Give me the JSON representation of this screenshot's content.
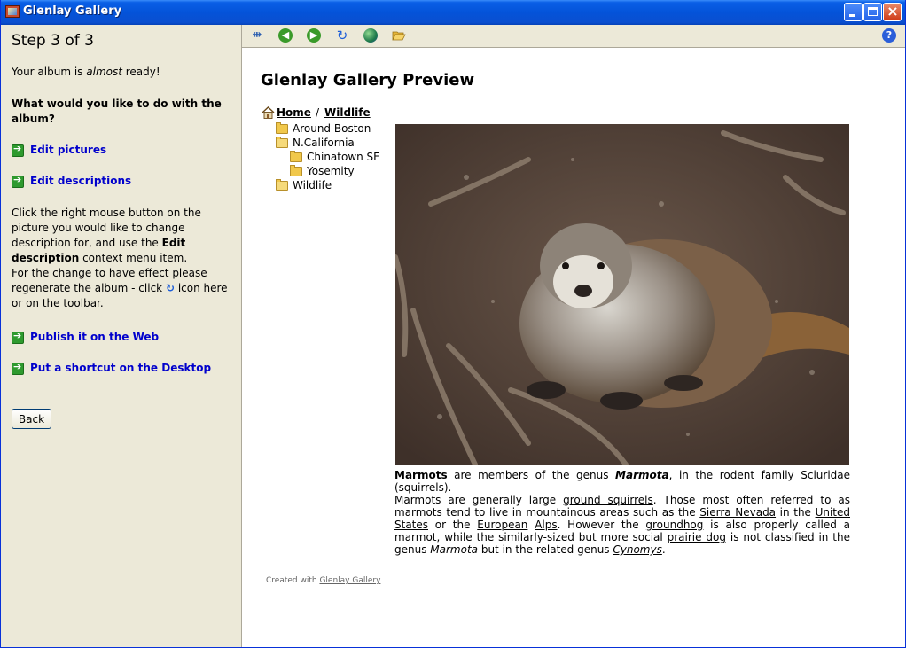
{
  "window": {
    "title": "Glenlay Gallery",
    "close_glyph": "×"
  },
  "left": {
    "step": "Step 3 of 3",
    "status_prefix": "Your album is ",
    "status_em": "almost",
    "status_suffix": " ready!",
    "question": "What would you like to do with the album?",
    "edit_pictures": "Edit pictures",
    "edit_descriptions": "Edit descriptions",
    "help_1": "Click the right mouse button on the picture you would like to change description for, and use the ",
    "help_bold": "Edit description",
    "help_2": " context menu item.",
    "help_3": "For the change to have effect please regenerate the album - click ",
    "help_4": " icon here or on the toolbar.",
    "publish": "Publish it on the Web",
    "shortcut": "Put a shortcut on the Desktop",
    "back": "Back"
  },
  "toolbar": {
    "back_glyph": "◀",
    "forward_glyph": "▶",
    "refresh_glyph": "↻",
    "help_glyph": "?"
  },
  "preview": {
    "title": "Glenlay Gallery Preview",
    "crumb_home": "Home",
    "crumb_sep": "/",
    "crumb_current": "Wildlife",
    "tree": [
      "Around Boston",
      "N.California",
      "Chinatown SF",
      "Yosemity",
      "Wildlife"
    ]
  },
  "caption": {
    "w1": "Marmots",
    "w2": " are members of the ",
    "w3": "genus",
    "w4": " ",
    "w5": "Marmota",
    "w6": ", in the ",
    "w7": "rodent",
    "w8": " family ",
    "w9": "Sciuridae",
    "w10": " (squirrels).",
    "p2a": "Marmots are generally large ",
    "p2b": "ground squirrels",
    "p2c": ". Those most often referred to as marmots tend to live in mountainous areas such as the ",
    "p2d": "Sierra Nevada",
    "p2e": " in the ",
    "p2f": "United States",
    "p2g": " or the ",
    "p2h": "European",
    "p2i": " ",
    "p2j": "Alps",
    "p2k": ". However the ",
    "p2l": "groundhog",
    "p2m": " is also properly called a marmot, while the similarly-sized but more social ",
    "p2n": "prairie dog",
    "p2o": " is not classified in the genus ",
    "p2p": "Marmota",
    "p2q": " but in the related genus ",
    "p2r": "Cynomys",
    "p2s": "."
  },
  "footer": {
    "created_prefix": "Created with ",
    "created_link": "Glenlay Gallery"
  },
  "colors": {
    "link": "#0000cc",
    "titlebar": "#0453D9",
    "pane": "#ECE9D8"
  }
}
